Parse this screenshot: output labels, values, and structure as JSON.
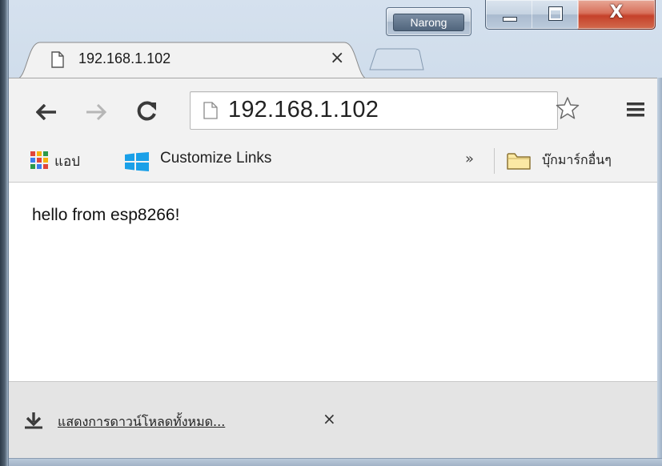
{
  "window": {
    "profile_name": "Narong",
    "minimize_glyph": "",
    "maximize_glyph": "",
    "close_glyph": "X"
  },
  "tabs": [
    {
      "title": "192.168.1.102",
      "close_glyph": "×"
    }
  ],
  "toolbar": {
    "back_icon": "back-arrow-icon",
    "forward_icon": "forward-arrow-icon",
    "reload_icon": "reload-icon",
    "address": "192.168.1.102",
    "star_icon": "bookmark-star-icon",
    "menu_icon": "hamburger-menu-icon"
  },
  "bookmarks": {
    "apps_label": "แอป",
    "customize_label": "Customize Links",
    "overflow_glyph": "»",
    "other_label": "บุ๊กมาร์กอื่นๆ"
  },
  "content": {
    "text": "hello from esp8266!"
  },
  "download_shelf": {
    "show_all_label": "แสดงการดาวน์โหลดทั้งหมด...",
    "close_glyph": "×"
  },
  "colors": {
    "frame": "#c3d3e5",
    "toolbar": "#f2f2f2",
    "close_button": "#c5412a",
    "shelf": "#e4e4e4"
  }
}
